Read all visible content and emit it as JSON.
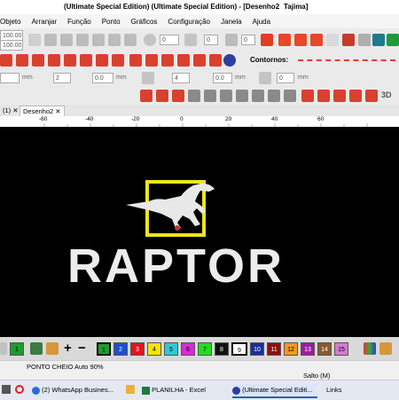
{
  "window": {
    "title": "(Ultimate Special Edition) (Ultimate Special Edition) - [Desenho2",
    "title_suffix": "Tajima]"
  },
  "menu": [
    "Objeto",
    "Arranjar",
    "Função",
    "Ponto",
    "Gráficos",
    "Configuração",
    "Janela",
    "Ajuda"
  ],
  "toolbar": {
    "size_top": "100.00",
    "size_bottom": "100.00",
    "rotate_value": "0",
    "field_a": "0",
    "field_b": "0",
    "contornos_label": "Contornos:",
    "mm_label_1": "mm",
    "mm_label_2": "mm",
    "mm_label_3": "mm",
    "mm_label_4": "mm",
    "spin_1": "2",
    "spin_2": "0.0",
    "spin_3": "4",
    "spin_4": "0.0",
    "spin_5": "0",
    "spin_6": "0",
    "view_3d": "3D"
  },
  "tabs": [
    {
      "label": "(1)",
      "close": "✕"
    },
    {
      "label": "Desenho2",
      "close": "✕"
    }
  ],
  "ruler": {
    "ticks": [
      "-60",
      "-40",
      "-20",
      "0",
      "20",
      "40",
      "60"
    ]
  },
  "design": {
    "text": "RAPTOR"
  },
  "palette": {
    "colors": [
      {
        "n": "1",
        "c": "#1a9e2e"
      },
      {
        "n": "1",
        "c": "#1a9e2e"
      },
      {
        "n": "2",
        "c": "#1d4fd1"
      },
      {
        "n": "3",
        "c": "#e5141b"
      },
      {
        "n": "4",
        "c": "#f5e400"
      },
      {
        "n": "5",
        "c": "#2ec9d6"
      },
      {
        "n": "6",
        "c": "#d62ad6"
      },
      {
        "n": "7",
        "c": "#22dd22"
      },
      {
        "n": "8",
        "c": "#111111"
      },
      {
        "n": "9",
        "c": "#ffffff"
      },
      {
        "n": "10",
        "c": "#1b2e9a"
      },
      {
        "n": "11",
        "c": "#8a1010"
      },
      {
        "n": "12",
        "c": "#f09a1e"
      },
      {
        "n": "13",
        "c": "#9a1ea0"
      },
      {
        "n": "14",
        "c": "#8a5a30"
      },
      {
        "n": "15",
        "c": "#d67ad0"
      }
    ]
  },
  "status": {
    "stitch_type": "PONTO CHEIO Auto 90%",
    "jump": "Salto (M)"
  },
  "taskbar": {
    "items": [
      {
        "label": "(2) WhatsApp Busines..."
      },
      {
        "label": "PLANILHA - Excel"
      },
      {
        "label": "(Ultimate Special Editi..."
      },
      {
        "label": "Links"
      }
    ]
  }
}
